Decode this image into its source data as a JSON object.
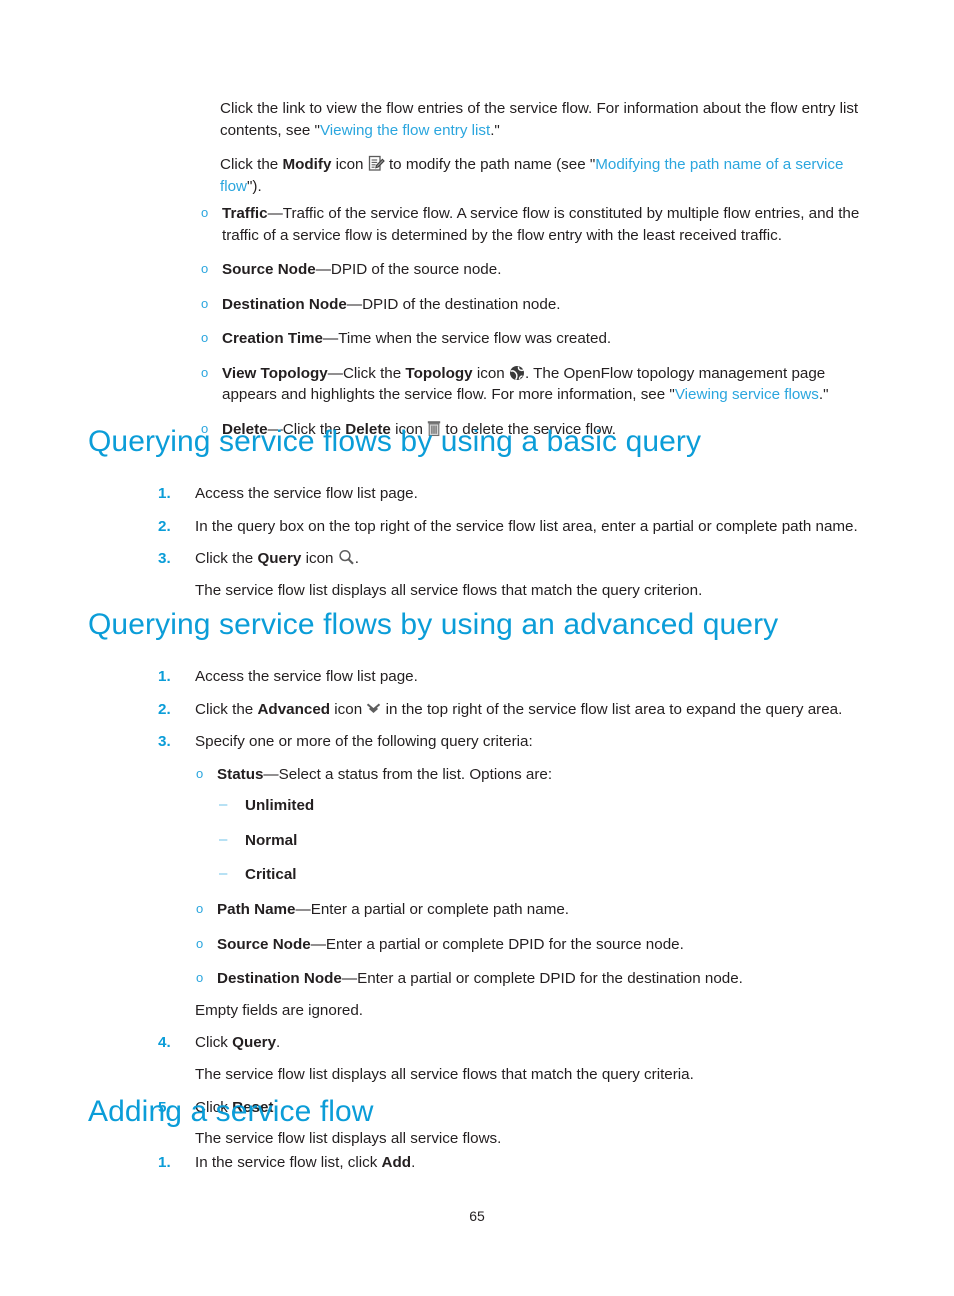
{
  "page": {
    "number": "65",
    "heading_color": "#0b9dd8",
    "link_color": "#2ba6de",
    "body_color": "#231f20",
    "bullet_color": "#2ba6de",
    "dash_color": "#6fc3e8"
  },
  "intro": {
    "para1_a": "Click the link to view the flow entries of the service flow. For information about the flow entry list contents, see \"",
    "para1_link": "Viewing the flow entry list",
    "para1_b": ".\"",
    "para2_a": "Click the ",
    "para2_bold": "Modify",
    "para2_b": " icon ",
    "para2_c": " to modify the path name (see \"",
    "para2_link": "Modifying the path name of a service flow",
    "para2_d": "\").",
    "modify_icon": "modify-document-pencil-icon"
  },
  "field_list": [
    {
      "term": "Traffic",
      "sep": "—",
      "desc": "Traffic of the service flow. A service flow is constituted by multiple flow entries, and the traffic of a service flow is determined by the flow entry with the least received traffic."
    },
    {
      "term": "Source Node",
      "sep": "—",
      "desc": "DPID of the source node."
    },
    {
      "term": "Destination Node",
      "sep": "—",
      "desc": "DPID of the destination node."
    },
    {
      "term": "Creation Time",
      "sep": "—",
      "desc": "Time when the service flow was created."
    }
  ],
  "view_topology": {
    "term": "View Topology",
    "sep": "—",
    "text_a": "Click the ",
    "bold": "Topology",
    "text_b": " icon ",
    "text_c": ". The OpenFlow topology management page appears and highlights the service flow. For more information, see \"",
    "link": "Viewing service flows",
    "text_d": ".\"",
    "icon": "topology-globe-icon"
  },
  "delete_item": {
    "term": "Delete",
    "sep": "—",
    "text_a": "Click the ",
    "bold": "Delete",
    "text_b": " icon ",
    "text_c": " to delete the service flow.",
    "icon": "trash-delete-icon"
  },
  "section_basic": {
    "heading": "Querying service flows by using a basic query",
    "steps": [
      {
        "num": "1.",
        "text": "Access the service flow list page."
      },
      {
        "num": "2.",
        "text": "In the query box on the top right of the service flow list area, enter a partial or complete path name."
      }
    ],
    "step3": {
      "num": "3.",
      "text_a": "Click the ",
      "bold": "Query",
      "text_b": " icon ",
      "text_c": ".",
      "icon": "query-magnifier-icon",
      "result": "The service flow list displays all service flows that match the query criterion."
    }
  },
  "section_advanced": {
    "heading": "Querying service flows by using an advanced query",
    "step1": {
      "num": "1.",
      "text": "Access the service flow list page."
    },
    "step2": {
      "num": "2.",
      "text_a": "Click the ",
      "bold": "Advanced",
      "text_b": " icon ",
      "text_c": " in the top right of the service flow list area to expand the query area.",
      "icon": "advanced-double-chevron-down-icon"
    },
    "step3": {
      "num": "3.",
      "text": "Specify one or more of the following query criteria:",
      "criteria": [
        {
          "term": "Status",
          "sep": "—",
          "desc": "Select a status from the list. Options are:",
          "options": [
            "Unlimited",
            "Normal",
            "Critical"
          ]
        },
        {
          "term": "Path Name",
          "sep": "—",
          "desc": "Enter a partial or complete path name."
        },
        {
          "term": "Source Node",
          "sep": "—",
          "desc": "Enter a partial or complete DPID for the source node."
        },
        {
          "term": "Destination Node",
          "sep": "—",
          "desc": "Enter a partial or complete DPID for the destination node."
        }
      ],
      "note": "Empty fields are ignored."
    },
    "step4": {
      "num": "4.",
      "text_a": "Click ",
      "bold": "Query",
      "text_b": ".",
      "result": "The service flow list displays all service flows that match the query criteria."
    },
    "step5": {
      "num": "5.",
      "text_a": "Click ",
      "bold": "Reset",
      "text_b": ".",
      "result": "The service flow list displays all service flows."
    }
  },
  "section_adding": {
    "heading": "Adding a service flow",
    "step1": {
      "num": "1.",
      "text_a": "In the service flow list, click ",
      "bold": "Add",
      "text_b": "."
    }
  }
}
